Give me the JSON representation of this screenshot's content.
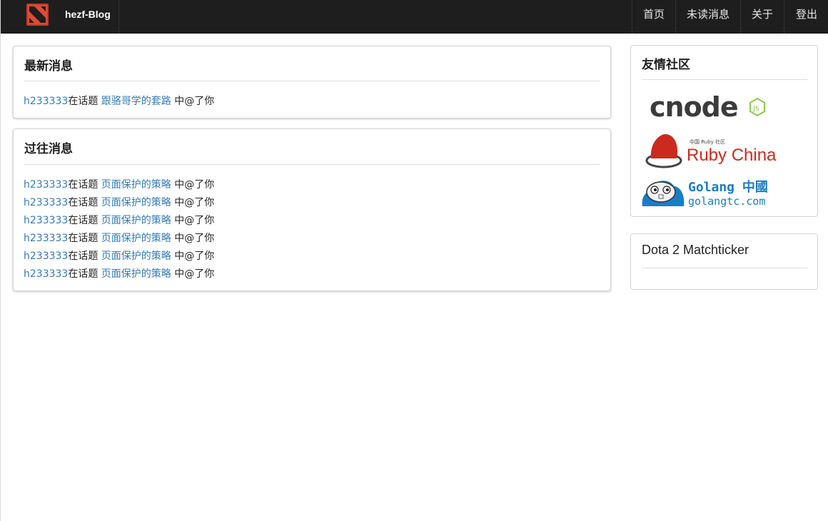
{
  "navbar": {
    "brand": "hezf-Blog",
    "items": [
      "首页",
      "未读消息",
      "关于",
      "登出"
    ]
  },
  "latest": {
    "title": "最新消息",
    "messages": [
      {
        "user": "h233333",
        "pre": "在话题",
        "topic": "跟骆哥学的套路",
        "post": "中@了你"
      }
    ]
  },
  "past": {
    "title": "过往消息",
    "messages": [
      {
        "user": "h233333",
        "pre": "在话题",
        "topic": "页面保护的策略",
        "post": "中@了你"
      },
      {
        "user": "h233333",
        "pre": "在话题",
        "topic": "页面保护的策略",
        "post": "中@了你"
      },
      {
        "user": "h233333",
        "pre": "在话题",
        "topic": "页面保护的策略",
        "post": "中@了你"
      },
      {
        "user": "h233333",
        "pre": "在话题",
        "topic": "页面保护的策略",
        "post": "中@了你"
      },
      {
        "user": "h233333",
        "pre": "在话题",
        "topic": "页面保护的策略",
        "post": "中@了你"
      },
      {
        "user": "h233333",
        "pre": "在话题",
        "topic": "页面保护的策略",
        "post": "中@了你"
      }
    ]
  },
  "friends": {
    "title": "友情社区",
    "logos": {
      "cnode": {
        "text": "cnode",
        "badge": "js"
      },
      "ruby": {
        "small": "中国 Ruby 社区",
        "name": "Ruby China"
      },
      "golang": {
        "title": "Golang 中國",
        "url": "golangtc.com"
      }
    }
  },
  "matchticker": {
    "title": "Dota 2 Matchticker"
  },
  "colors": {
    "navbar": "#1e1e1e",
    "link": "#337ab7",
    "ruby_red": "#cc2a1e",
    "golang_blue": "#1a7dc4",
    "node_green": "#8cc84b"
  }
}
